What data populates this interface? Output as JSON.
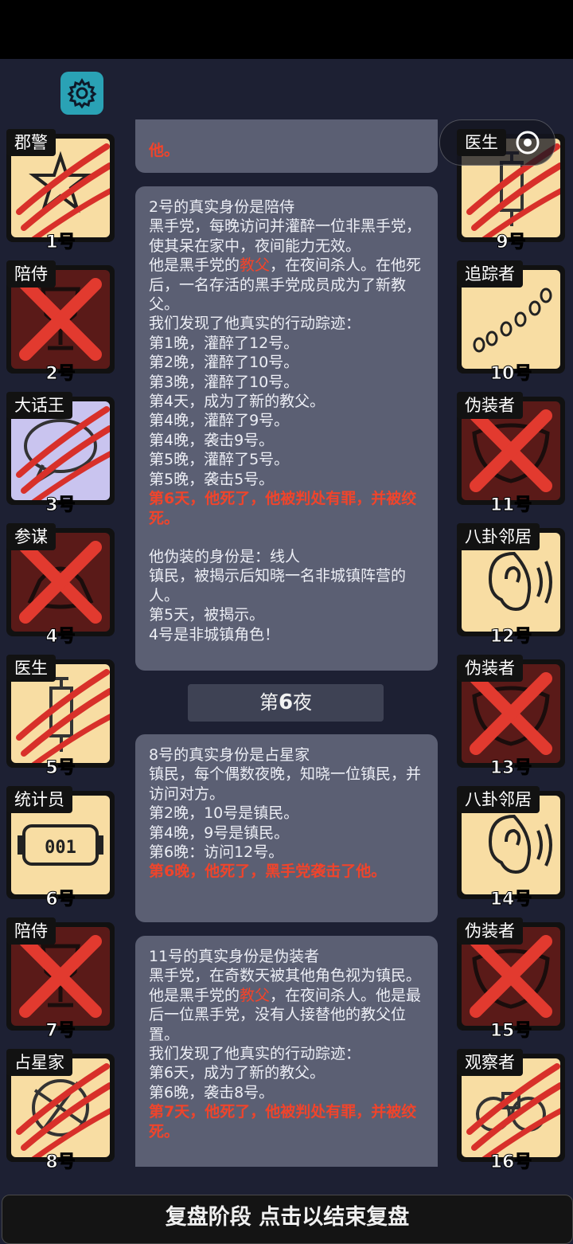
{
  "settings_icon": "gear-icon",
  "capsule": {
    "more_icon": "more-dots-icon",
    "close_icon": "target-icon"
  },
  "left_players": [
    {
      "role": "郡警",
      "num": "1号",
      "state": "slashed",
      "icon": "sheriff-badge-icon"
    },
    {
      "role": "陪侍",
      "num": "2号",
      "state": "dead",
      "icon": "wine-glass-icon"
    },
    {
      "role": "大话王",
      "num": "3号",
      "state": "slashed-lilac",
      "icon": "speech-bubble-icon"
    },
    {
      "role": "参谋",
      "num": "4号",
      "state": "dead",
      "icon": "hat-icon"
    },
    {
      "role": "医生",
      "num": "5号",
      "state": "slashed",
      "icon": "syringe-icon"
    },
    {
      "role": "统计员",
      "num": "6号",
      "state": "alive",
      "icon": "counter-icon",
      "counter": "001"
    },
    {
      "role": "陪侍",
      "num": "7号",
      "state": "dead",
      "icon": "wine-glass-icon"
    },
    {
      "role": "占星家",
      "num": "8号",
      "state": "slashed",
      "icon": "astrolabe-icon"
    }
  ],
  "right_players": [
    {
      "role": "医生",
      "num": "9号",
      "state": "slashed",
      "icon": "syringe-icon"
    },
    {
      "role": "追踪者",
      "num": "10号",
      "state": "alive",
      "icon": "footprints-icon"
    },
    {
      "role": "伪装者",
      "num": "11号",
      "state": "dead",
      "icon": "mask-icon"
    },
    {
      "role": "八卦邻居",
      "num": "12号",
      "state": "alive",
      "icon": "ear-icon"
    },
    {
      "role": "伪装者",
      "num": "13号",
      "state": "dead",
      "icon": "mask-icon"
    },
    {
      "role": "八卦邻居",
      "num": "14号",
      "state": "alive",
      "icon": "ear-icon"
    },
    {
      "role": "伪装者",
      "num": "15号",
      "state": "dead",
      "icon": "mask-icon"
    },
    {
      "role": "观察者",
      "num": "16号",
      "state": "slashed",
      "icon": "binoculars-icon"
    }
  ],
  "log": {
    "msg0_tail": "他。",
    "msg1": {
      "title": "2号的真实身份是陪侍",
      "desc": "黑手党，每晚访问并灌醉一位非黑手党，使其呆在家中，夜间能力无效。",
      "godfather_a": "他是黑手党的",
      "godfather_hl": "教父",
      "godfather_b": "，在夜间杀人。在他死后，一名存活的黑手党成员成为了新教父。",
      "trace": "我们发现了他真实的行动踪迹：",
      "actions": [
        "第1晚，灌醉了12号。",
        "第2晚，灌醉了10号。",
        "第3晚，灌醉了10号。",
        "第4天，成为了新的教父。",
        "第4晚，灌醉了9号。",
        "第4晚，袭击9号。",
        "第5晚，灌醉了5号。",
        "第5晚，袭击5号。"
      ],
      "death": "第6天，他死了，他被判处有罪，并被绞死。",
      "disguise": "他伪装的身份是：线人",
      "disguise_desc": "镇民，被揭示后知晓一名非城镇阵营的人。",
      "revealed": "第5天，被揭示。",
      "finding": "4号是非城镇角色！"
    },
    "night_prefix": "第",
    "night_num": "6",
    "night_suffix": "夜",
    "msg2": {
      "title": "8号的真实身份是占星家",
      "desc": "镇民，每个偶数夜晚，知晓一位镇民，并访问对方。",
      "actions": [
        "第2晚，10号是镇民。",
        "第4晚，9号是镇民。",
        "第6晚：访问12号。"
      ],
      "death": "第6晚，他死了，黑手党袭击了他。"
    },
    "msg3": {
      "title": "11号的真实身份是伪装者",
      "desc": "黑手党，在奇数天被其他角色视为镇民。",
      "godfather_a": "他是黑手党的",
      "godfather_hl": "教父",
      "godfather_b": "，在夜间杀人。他是最后一位黑手党，没有人接替他的教父位置。",
      "trace": "我们发现了他真实的行动踪迹：",
      "actions": [
        "第6天，成为了新的教父。",
        "第6晚，袭击8号。"
      ],
      "death": "第7天，他死了，他被判处有罪，并被绞死。"
    }
  },
  "bottom_label": "复盘阶段 点击以结束复盘",
  "colors": {
    "accent_red": "#f0442b",
    "gear_bg": "#2aa2b5",
    "alive_card": "#f8dda3",
    "dead_card": "#5a1a18"
  }
}
